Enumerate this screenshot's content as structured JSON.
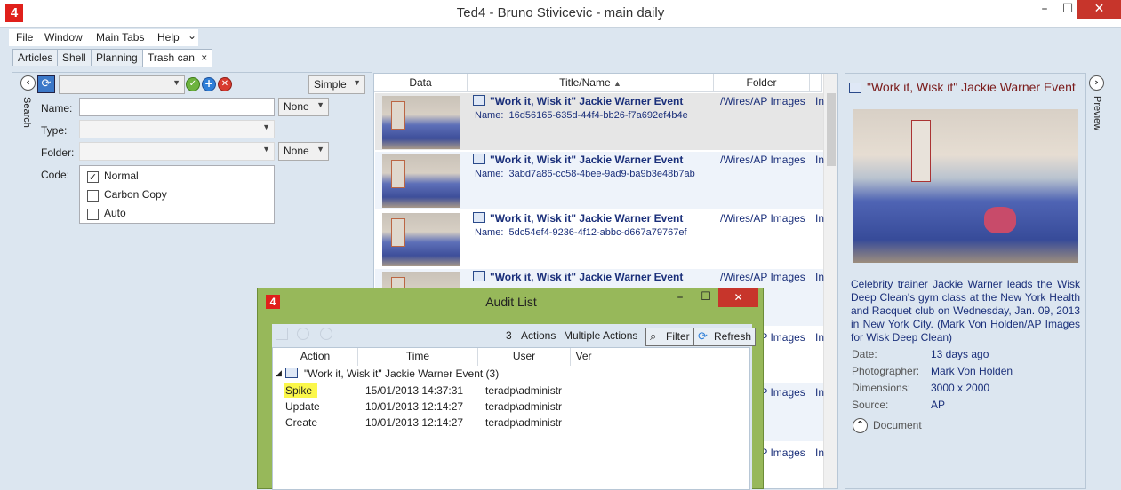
{
  "app": {
    "logo": "4",
    "title": "Ted4 - Bruno Stivicevic - main daily"
  },
  "window_controls": {
    "minimize": "–",
    "maximize": "☐",
    "close": "✕"
  },
  "menu": [
    "File",
    "Window",
    "Main Tabs",
    "Help"
  ],
  "menu_overflow": "⌄",
  "tabs": [
    {
      "label": "Articles"
    },
    {
      "label": "Shell"
    },
    {
      "label": "Planning"
    },
    {
      "label": "Trash can",
      "close": "×"
    }
  ],
  "search": {
    "vertical_label": "Search",
    "mode": "Simple",
    "fields": {
      "name_label": "Name:",
      "name_value": "",
      "name_modifier": "None",
      "type_label": "Type:",
      "folder_label": "Folder:",
      "folder_modifier": "None",
      "code_label": "Code:"
    },
    "code_options": [
      {
        "label": "Normal",
        "checked": true
      },
      {
        "label": "Carbon Copy",
        "checked": false
      },
      {
        "label": "Auto",
        "checked": false
      }
    ]
  },
  "results": {
    "columns": [
      "Data",
      "Title/Name",
      "Folder"
    ],
    "sort_indicator": "▲",
    "rows": [
      {
        "title": "\"Work it, Wisk it\" Jackie Warner Event",
        "name_label": "Name:",
        "name": "16d56165-635d-44f4-bb26-f7a692ef4b4e",
        "folder": "/Wires/AP Images",
        "extra": "In"
      },
      {
        "title": "\"Work it, Wisk it\" Jackie Warner Event",
        "name_label": "Name:",
        "name": "3abd7a86-cc58-4bee-9ad9-ba9b3e48b7ab",
        "folder": "/Wires/AP Images",
        "extra": "In"
      },
      {
        "title": "\"Work it, Wisk it\" Jackie Warner Event",
        "name_label": "Name:",
        "name": "5dc54ef4-9236-4f12-abbc-d667a79767ef",
        "folder": "/Wires/AP Images",
        "extra": "In"
      },
      {
        "title": "\"Work it, Wisk it\" Jackie Warner Event",
        "name_label": "",
        "name": "",
        "folder": "/Wires/AP Images",
        "extra": "In"
      }
    ],
    "hidden_rows": [
      {
        "folder": "/Wires/AP Images",
        "extra": "In"
      },
      {
        "folder": "/Wires/AP Images",
        "extra": "In"
      },
      {
        "folder": "/Wires/AP Images",
        "extra": "In"
      }
    ]
  },
  "preview": {
    "vertical_label": "Preview",
    "title": "\"Work it, Wisk it\" Jackie Warner Event",
    "caption": "Celebrity trainer Jackie Warner leads the Wisk Deep Clean's gym class at the New York Health and Racquet club on Wednesday, Jan. 09, 2013 in New York City. (Mark Von Holden/AP Images for Wisk Deep Clean)",
    "details": [
      {
        "label": "Date:",
        "value": "13 days ago"
      },
      {
        "label": "Photographer:",
        "value": "Mark Von Holden"
      },
      {
        "label": "Dimensions:",
        "value": "3000 x 2000"
      },
      {
        "label": "Source:",
        "value": "AP"
      }
    ],
    "document_label": "Document"
  },
  "audit": {
    "title": "Audit List",
    "logo": "4",
    "count": "3",
    "actions_label": "Actions",
    "multiple_actions": "Multiple Actions",
    "filter_label": "Filter",
    "refresh_label": "Refresh",
    "columns": [
      "Action",
      "Time",
      "User",
      "Ver"
    ],
    "group": "\"Work it, Wisk it\" Jackie Warner Event (3)",
    "rows": [
      {
        "action": "Spike",
        "time": "15/01/2013 14:37:31",
        "user": "teradp\\administr",
        "highlight": true
      },
      {
        "action": "Update",
        "time": "10/01/2013 12:14:27",
        "user": "teradp\\administr",
        "highlight": false
      },
      {
        "action": "Create",
        "time": "10/01/2013 12:14:27",
        "user": "teradp\\administr",
        "highlight": false
      }
    ],
    "highlight_color": "#fbf74a"
  },
  "colors": {
    "accent": "#1a2f7a",
    "logo": "#e0201b",
    "dialog_border": "#97b85a",
    "close": "#c7352b"
  }
}
